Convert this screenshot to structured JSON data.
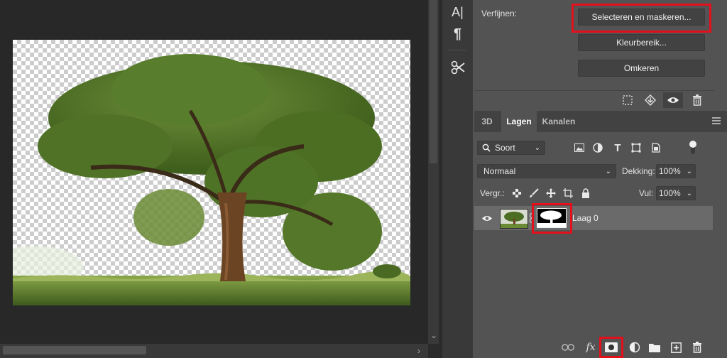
{
  "toolbar": {
    "tools": [
      {
        "icon": "text-vertical-icon"
      },
      {
        "icon": "paragraph-icon"
      },
      {
        "icon": "tool-presets-icon"
      }
    ],
    "text_tool_glyph": "A|",
    "paragraph_glyph": "¶"
  },
  "properties": {
    "section_label": "Verfijnen:",
    "buttons": {
      "select_and_mask": "Selecteren en maskeren...",
      "color_range": "Kleurbereik...",
      "invert": "Omkeren"
    },
    "footer_icons": [
      "selection-icon",
      "apply-mask-icon",
      "eye-icon",
      "trash-icon"
    ]
  },
  "layers_panel": {
    "tabs": [
      {
        "label": "3D",
        "active": false
      },
      {
        "label": "Lagen",
        "active": true
      },
      {
        "label": "Kanalen",
        "active": false
      }
    ],
    "filter": {
      "label": "Soort"
    },
    "blend_mode": "Normaal",
    "opacity_label": "Dekking:",
    "opacity_value": "100%",
    "lock_label": "Vergr.:",
    "fill_label": "Vul:",
    "fill_value": "100%",
    "layers": [
      {
        "name": "Laag 0",
        "visible": true,
        "has_mask": true
      }
    ],
    "footer_icons": [
      "link-icon",
      "fx-icon",
      "add-mask-icon",
      "adjustment-icon",
      "folder-icon",
      "new-layer-icon",
      "trash-icon"
    ],
    "fx_glyph": "fx"
  },
  "colors": {
    "highlight": "#e3101c",
    "panel": "#535353",
    "workspace": "#282828"
  }
}
